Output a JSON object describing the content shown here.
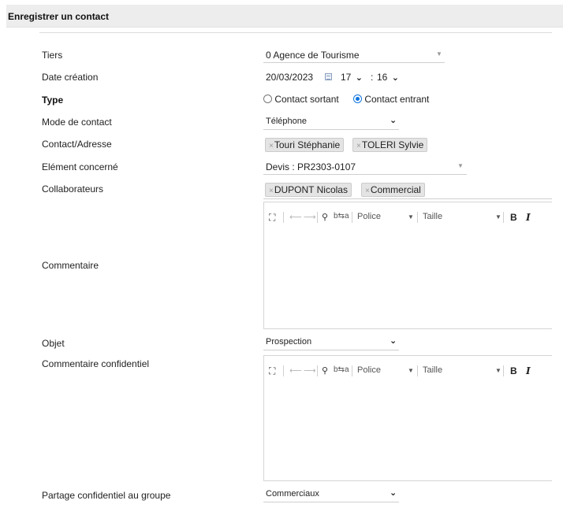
{
  "header": {
    "title": "Enregistrer un contact"
  },
  "fields": {
    "tiers": {
      "label": "Tiers",
      "value": "0 Agence de Tourisme"
    },
    "date_creation": {
      "label": "Date création",
      "date": "20/03/2023",
      "hour": "17",
      "minute": "16",
      "separator": ":"
    },
    "type": {
      "label": "Type",
      "option_out": "Contact sortant",
      "option_in": "Contact entrant",
      "selected": "Contact entrant"
    },
    "mode_contact": {
      "label": "Mode de contact",
      "value": "Téléphone"
    },
    "contact_adresse": {
      "label": "Contact/Adresse",
      "tags": [
        "Touri Stéphanie",
        "TOLERI Sylvie"
      ]
    },
    "element_concerne": {
      "label": "Elément concerné",
      "value": "Devis : PR2303-0107"
    },
    "collaborateurs": {
      "label": "Collaborateurs",
      "tags": [
        "DUPONT Nicolas",
        "Commercial"
      ]
    },
    "commentaire": {
      "label": "Commentaire"
    },
    "objet": {
      "label": "Objet",
      "value": "Prospection"
    },
    "commentaire_confidentiel": {
      "label": "Commentaire confidentiel"
    },
    "partage": {
      "label": "Partage confidentiel au groupe",
      "value": "Commerciaux"
    }
  },
  "editor_toolbar": {
    "font_label": "Police",
    "size_label": "Taille",
    "bold": "B",
    "italic": "I",
    "replace_glyph": "b⇆a",
    "tag_remove": "×"
  },
  "icons": [
    "maximize-icon",
    "undo-icon",
    "redo-icon",
    "find-icon",
    "replace-icon",
    "calendar-icon",
    "chevron-down-icon",
    "caret-down-icon"
  ]
}
